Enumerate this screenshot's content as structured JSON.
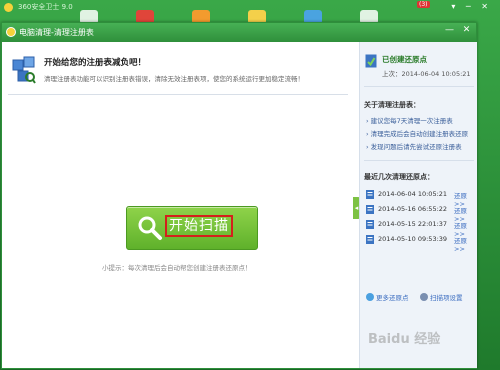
{
  "background": {
    "app_title": "360安全卫士 9.0",
    "badge": "(3)"
  },
  "dialog": {
    "title": "电脑清理-清理注册表",
    "min_glyph": "—",
    "close_glyph": "✕"
  },
  "main": {
    "heading": "开始给您的注册表减负吧！",
    "description": "清理注册表功能可以识别注册表错误，清除无效注册表项，使您的系统运行更加稳定流畅！",
    "scan_button": "开始扫描",
    "tip": "小提示：每次清理后会自动帮您创建注册表还原点！"
  },
  "sidebar": {
    "created_label": "已创建还原点",
    "last_label": "上次：2014-06-04 10:05:21",
    "about_title": "关于清理注册表：",
    "about_items": [
      "建议您每7天清理一次注册表",
      "清理完成后会自动创建注册表还原",
      "发现问题后请先尝试还原注册表"
    ],
    "recent_title": "最近几次清理还原点：",
    "restore_points": [
      {
        "date": "2014-06-04 10:05:21",
        "action": "还原>>"
      },
      {
        "date": "2014-05-16 06:55:22",
        "action": "还原>>"
      },
      {
        "date": "2014-05-15 22:01:37",
        "action": "还原>>"
      },
      {
        "date": "2014-05-10 09:53:39",
        "action": "还原>>"
      }
    ],
    "more_label": "更多还原点",
    "settings_label": "扫描项设置"
  },
  "watermark": "Baidu 经验",
  "colors": {
    "brand_green": "#2f8f3b",
    "button_green": "#6cbf33",
    "highlight_red": "#d4201c",
    "link_blue": "#3a6cc0"
  }
}
